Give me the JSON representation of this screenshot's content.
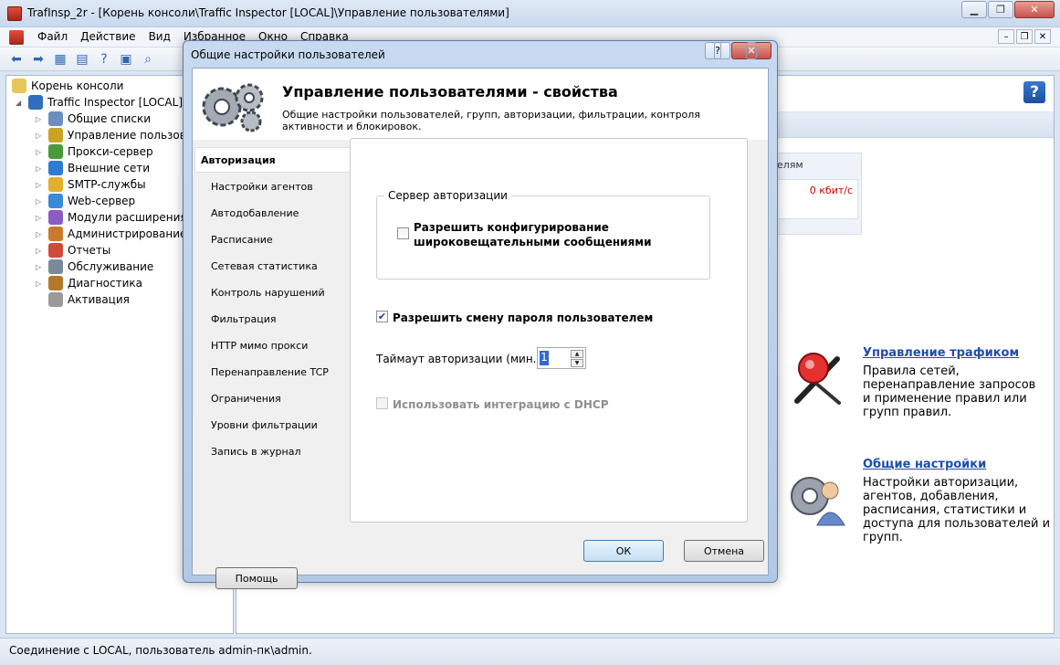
{
  "window": {
    "title": "TrafInsp_2r - [Корень консоли\\Traffic Inspector [LOCAL]\\Управление пользователями]",
    "minimize_icon": "minimize-icon",
    "maximize_icon": "maximize-icon",
    "close_icon": "close-icon"
  },
  "menubar": {
    "items": [
      "Файл",
      "Действие",
      "Вид",
      "Избранное",
      "Окно",
      "Справка"
    ]
  },
  "tree": {
    "root": "Корень консоли",
    "server": "Traffic Inspector [LOCAL]",
    "items": [
      {
        "label": "Общие списки",
        "icon": "list-icon",
        "color": "#6c8ebf"
      },
      {
        "label": "Управление пользовате",
        "icon": "users-icon",
        "color": "#c9a227"
      },
      {
        "label": "Прокси-сервер",
        "icon": "proxy-icon",
        "color": "#4a9a3a"
      },
      {
        "label": "Внешние сети",
        "icon": "globe-icon",
        "color": "#2e7bd1"
      },
      {
        "label": "SMTP-службы",
        "icon": "mail-icon",
        "color": "#e0b030"
      },
      {
        "label": "Web-сервер",
        "icon": "web-icon",
        "color": "#3a8ad8"
      },
      {
        "label": "Модули расширения",
        "icon": "puzzle-icon",
        "color": "#8a5cc2"
      },
      {
        "label": "Администрирование",
        "icon": "admin-icon",
        "color": "#c87b2c"
      },
      {
        "label": "Отчеты",
        "icon": "report-icon",
        "color": "#d04a3a"
      },
      {
        "label": "Обслуживание",
        "icon": "service-icon",
        "color": "#7a8a9a"
      },
      {
        "label": "Диагностика",
        "icon": "diagnostic-icon",
        "color": "#b07a2a"
      },
      {
        "label": "Активация",
        "icon": "key-icon",
        "color": "#9a9a9a"
      }
    ]
  },
  "right_pane": {
    "stats_label": "елям",
    "stats_value": "0 кбит/с",
    "feature1": {
      "title": "Управление трафиком",
      "desc": "Правила сетей, перенаправление запросов и применение правил или групп правил."
    },
    "feature2": {
      "title": "Общие настройки",
      "desc": "Настройки авторизации, агентов, добавления, расписания, статистики и доступа для пользователей и групп."
    }
  },
  "status": {
    "text": "Соединение с LOCAL, пользователь admin-пк\\admin."
  },
  "dialog": {
    "title": "Общие настройки пользователей",
    "header_title": "Управление пользователями - свойства",
    "header_subtitle": "Общие настройки пользователей, групп, авторизации, фильтрации, контроля активности и блокировок.",
    "nav": [
      "Авторизация",
      "Настройки агентов",
      "Автодобавление",
      "Расписание",
      "Сетевая статистика",
      "Контроль нарушений",
      "Фильтрация",
      "HTTP мимо прокси",
      "Перенаправление TCP",
      "Ограничения",
      "Уровни фильтрации",
      "Запись в журнал"
    ],
    "group_title": "Сервер авторизации",
    "broadcast_label_1": "Разрешить конфигурирование",
    "broadcast_label_2": "широковещательными сообщениями",
    "broadcast_checked": false,
    "password_change_label": "Разрешить смену пароля пользователем",
    "password_change_checked": true,
    "timeout_label": "Таймаут авторизации (мин.)",
    "timeout_value": "1",
    "dhcp_label": "Использовать интеграцию с DHCP",
    "dhcp_checked": false,
    "help_button": "Помощь",
    "ok_button": "ОК",
    "cancel_button": "Отмена"
  }
}
